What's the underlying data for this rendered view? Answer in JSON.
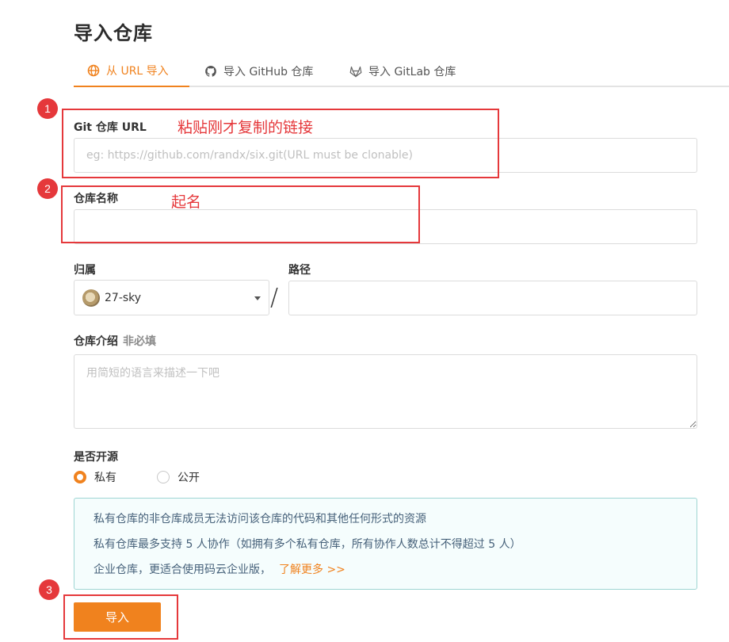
{
  "page_title": "导入仓库",
  "tabs": [
    {
      "label": "从 URL 导入",
      "icon": "globe-icon",
      "active": true
    },
    {
      "label": "导入 GitHub 仓库",
      "icon": "github-icon",
      "active": false
    },
    {
      "label": "导入 GitLab 仓库",
      "icon": "gitlab-icon",
      "active": false
    }
  ],
  "form": {
    "git_url_label": "Git 仓库 URL",
    "git_url_placeholder": "eg: https://github.com/randx/six.git(URL must be clonable)",
    "git_url_value": "",
    "repo_name_label": "仓库名称",
    "repo_name_value": "",
    "owner_label": "归属",
    "owner_value": "27-sky",
    "path_label": "路径",
    "path_value": "",
    "slash": "/",
    "desc_label": "仓库介绍",
    "desc_optional": "非必填",
    "desc_placeholder": "用简短的语言来描述一下吧",
    "open_source_label": "是否开源",
    "radio_private": "私有",
    "radio_public": "公开",
    "selected_visibility": "私有"
  },
  "info": {
    "line1": "私有仓库的非仓库成员无法访问该仓库的代码和其他任何形式的资源",
    "line2": "私有仓库最多支持 5 人协作（如拥有多个私有仓库，所有协作人数总计不得超过 5 人）",
    "line3": "企业仓库，更适合使用码云企业版，",
    "link": "了解更多 >>"
  },
  "submit_label": "导入",
  "annotations": {
    "num1": "1",
    "text1": "粘贴刚才复制的链接",
    "num2": "2",
    "text2": "起名",
    "num3": "3"
  },
  "colors": {
    "accent": "#f0821e",
    "annotation": "#e5383b",
    "info_border": "#9fd6d3"
  }
}
